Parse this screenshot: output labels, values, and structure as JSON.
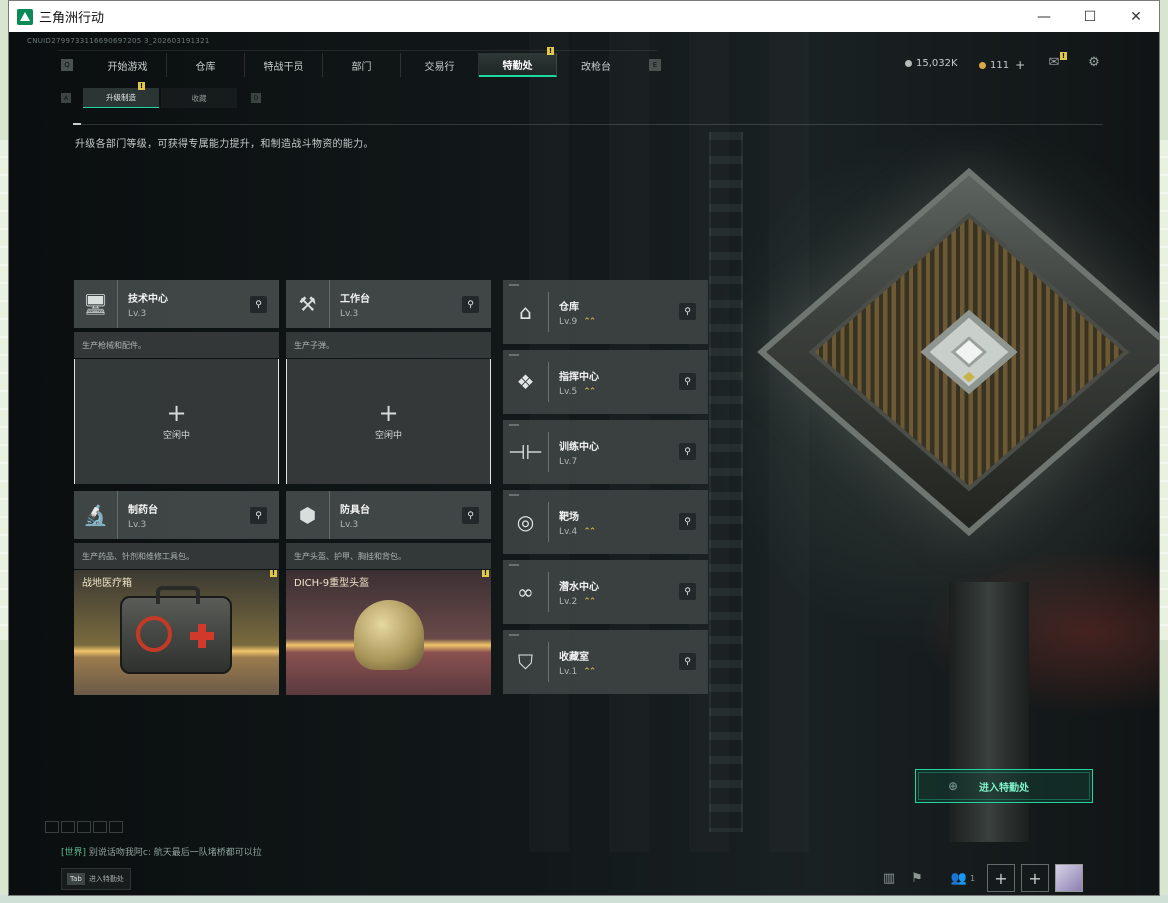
{
  "window": {
    "title": "三角洲行动",
    "min_glyph": "—",
    "max_glyph": "☐",
    "close_glyph": "✕"
  },
  "uid": "CNUID2799733116690697205 3_202603191321",
  "nav": {
    "left_key": "Q",
    "right_key": "E",
    "items": [
      {
        "label": "开始游戏"
      },
      {
        "label": "仓库"
      },
      {
        "label": "特战干员"
      },
      {
        "label": "部门"
      },
      {
        "label": "交易行"
      },
      {
        "label": "特勤处",
        "active": true,
        "badge": "!"
      },
      {
        "label": "改枪台"
      }
    ]
  },
  "currency": {
    "coins": "15,032K",
    "tokens": "111",
    "tokens_plus": "+"
  },
  "top_icons": {
    "mail_badge": "!"
  },
  "subtabs": {
    "left_key": "A",
    "right_key": "D",
    "items": [
      {
        "label": "升级制造",
        "badge": "!"
      },
      {
        "label": "收藏"
      }
    ]
  },
  "description": "升级各部门等级，可获得专属能力提升，和制造战斗物资的能力。",
  "production_departments": [
    {
      "name": "技术中心",
      "level": "Lv.3",
      "desc": "生产枪械和配件。",
      "slot": "idle"
    },
    {
      "name": "工作台",
      "level": "Lv.3",
      "desc": "生产子弹。",
      "slot": "idle"
    },
    {
      "name": "制药台",
      "level": "Lv.3",
      "desc": "生产药品、针剂和维修工具包。",
      "slot": "crafting",
      "item": "战地医疗箱",
      "badge": "!"
    },
    {
      "name": "防具台",
      "level": "Lv.3",
      "desc": "生产头盔、护甲、胸挂和背包。",
      "slot": "crafting",
      "item": "DICH-9重型头盔",
      "badge": "!"
    }
  ],
  "idle_label": "空闲中",
  "idle_plus": "+",
  "facilities": [
    {
      "name": "仓库",
      "level": "Lv.9",
      "upgradable": true
    },
    {
      "name": "指挥中心",
      "level": "Lv.5",
      "upgradable": true
    },
    {
      "name": "训练中心",
      "level": "Lv.7",
      "upgradable": false
    },
    {
      "name": "靶场",
      "level": "Lv.4",
      "upgradable": true
    },
    {
      "name": "潜水中心",
      "level": "Lv.2",
      "upgradable": true
    },
    {
      "name": "收藏室",
      "level": "Lv.1",
      "upgradable": true
    }
  ],
  "upgrade_glyph": "⌃⌃",
  "search_glyph": "⚲",
  "enter_button": "进入特勤处",
  "chat": {
    "channel": "[世界]",
    "message": "别说话吻我阿c: 航天最后一队堵桥都可以拉"
  },
  "tab_hint": {
    "key": "Tab",
    "label": "进入特勤处"
  },
  "bottom": {
    "friends_count": "1",
    "add_glyph": "+"
  },
  "colors": {
    "accent": "#1fd8a0",
    "warning": "#e3c948",
    "card": "#444a4a"
  }
}
